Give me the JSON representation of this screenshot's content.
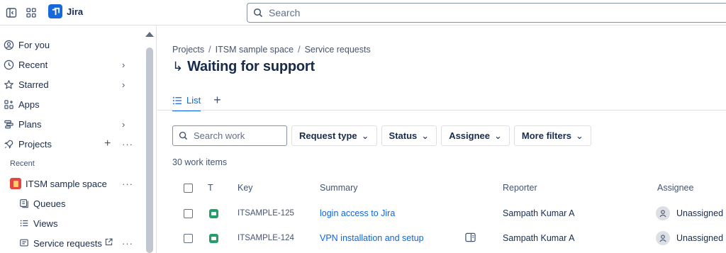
{
  "topbar": {
    "app_name": "Jira",
    "search_placeholder": "Search"
  },
  "sidebar": {
    "items": [
      {
        "label": "For you"
      },
      {
        "label": "Recent"
      },
      {
        "label": "Starred"
      },
      {
        "label": "Apps"
      },
      {
        "label": "Plans"
      },
      {
        "label": "Projects"
      }
    ],
    "recent_header": "Recent",
    "project_name": "ITSM sample space",
    "sub_items": [
      {
        "label": "Queues"
      },
      {
        "label": "Views"
      },
      {
        "label": "Service requests"
      }
    ]
  },
  "main": {
    "breadcrumbs": [
      "Projects",
      "ITSM sample space",
      "Service requests"
    ],
    "title": "Waiting for support",
    "tab_list": "List",
    "search_work_placeholder": "Search work",
    "filters": [
      "Request type",
      "Status",
      "Assignee",
      "More filters"
    ],
    "count": "30 work items",
    "columns": [
      "T",
      "Key",
      "Summary",
      "Reporter",
      "Assignee"
    ],
    "rows": [
      {
        "key": "ITSAMPLE-125",
        "summary": "login access to Jira",
        "reporter": "Sampath Kumar A",
        "assignee": "Unassigned"
      },
      {
        "key": "ITSAMPLE-124",
        "summary": "VPN installation and setup",
        "reporter": "Sampath Kumar A",
        "assignee": "Unassigned"
      }
    ]
  },
  "colors": {
    "accent": "#0c66e4",
    "brand": "#1868db",
    "type_icon": "#22a06b",
    "project_icon": "#e2483d"
  }
}
